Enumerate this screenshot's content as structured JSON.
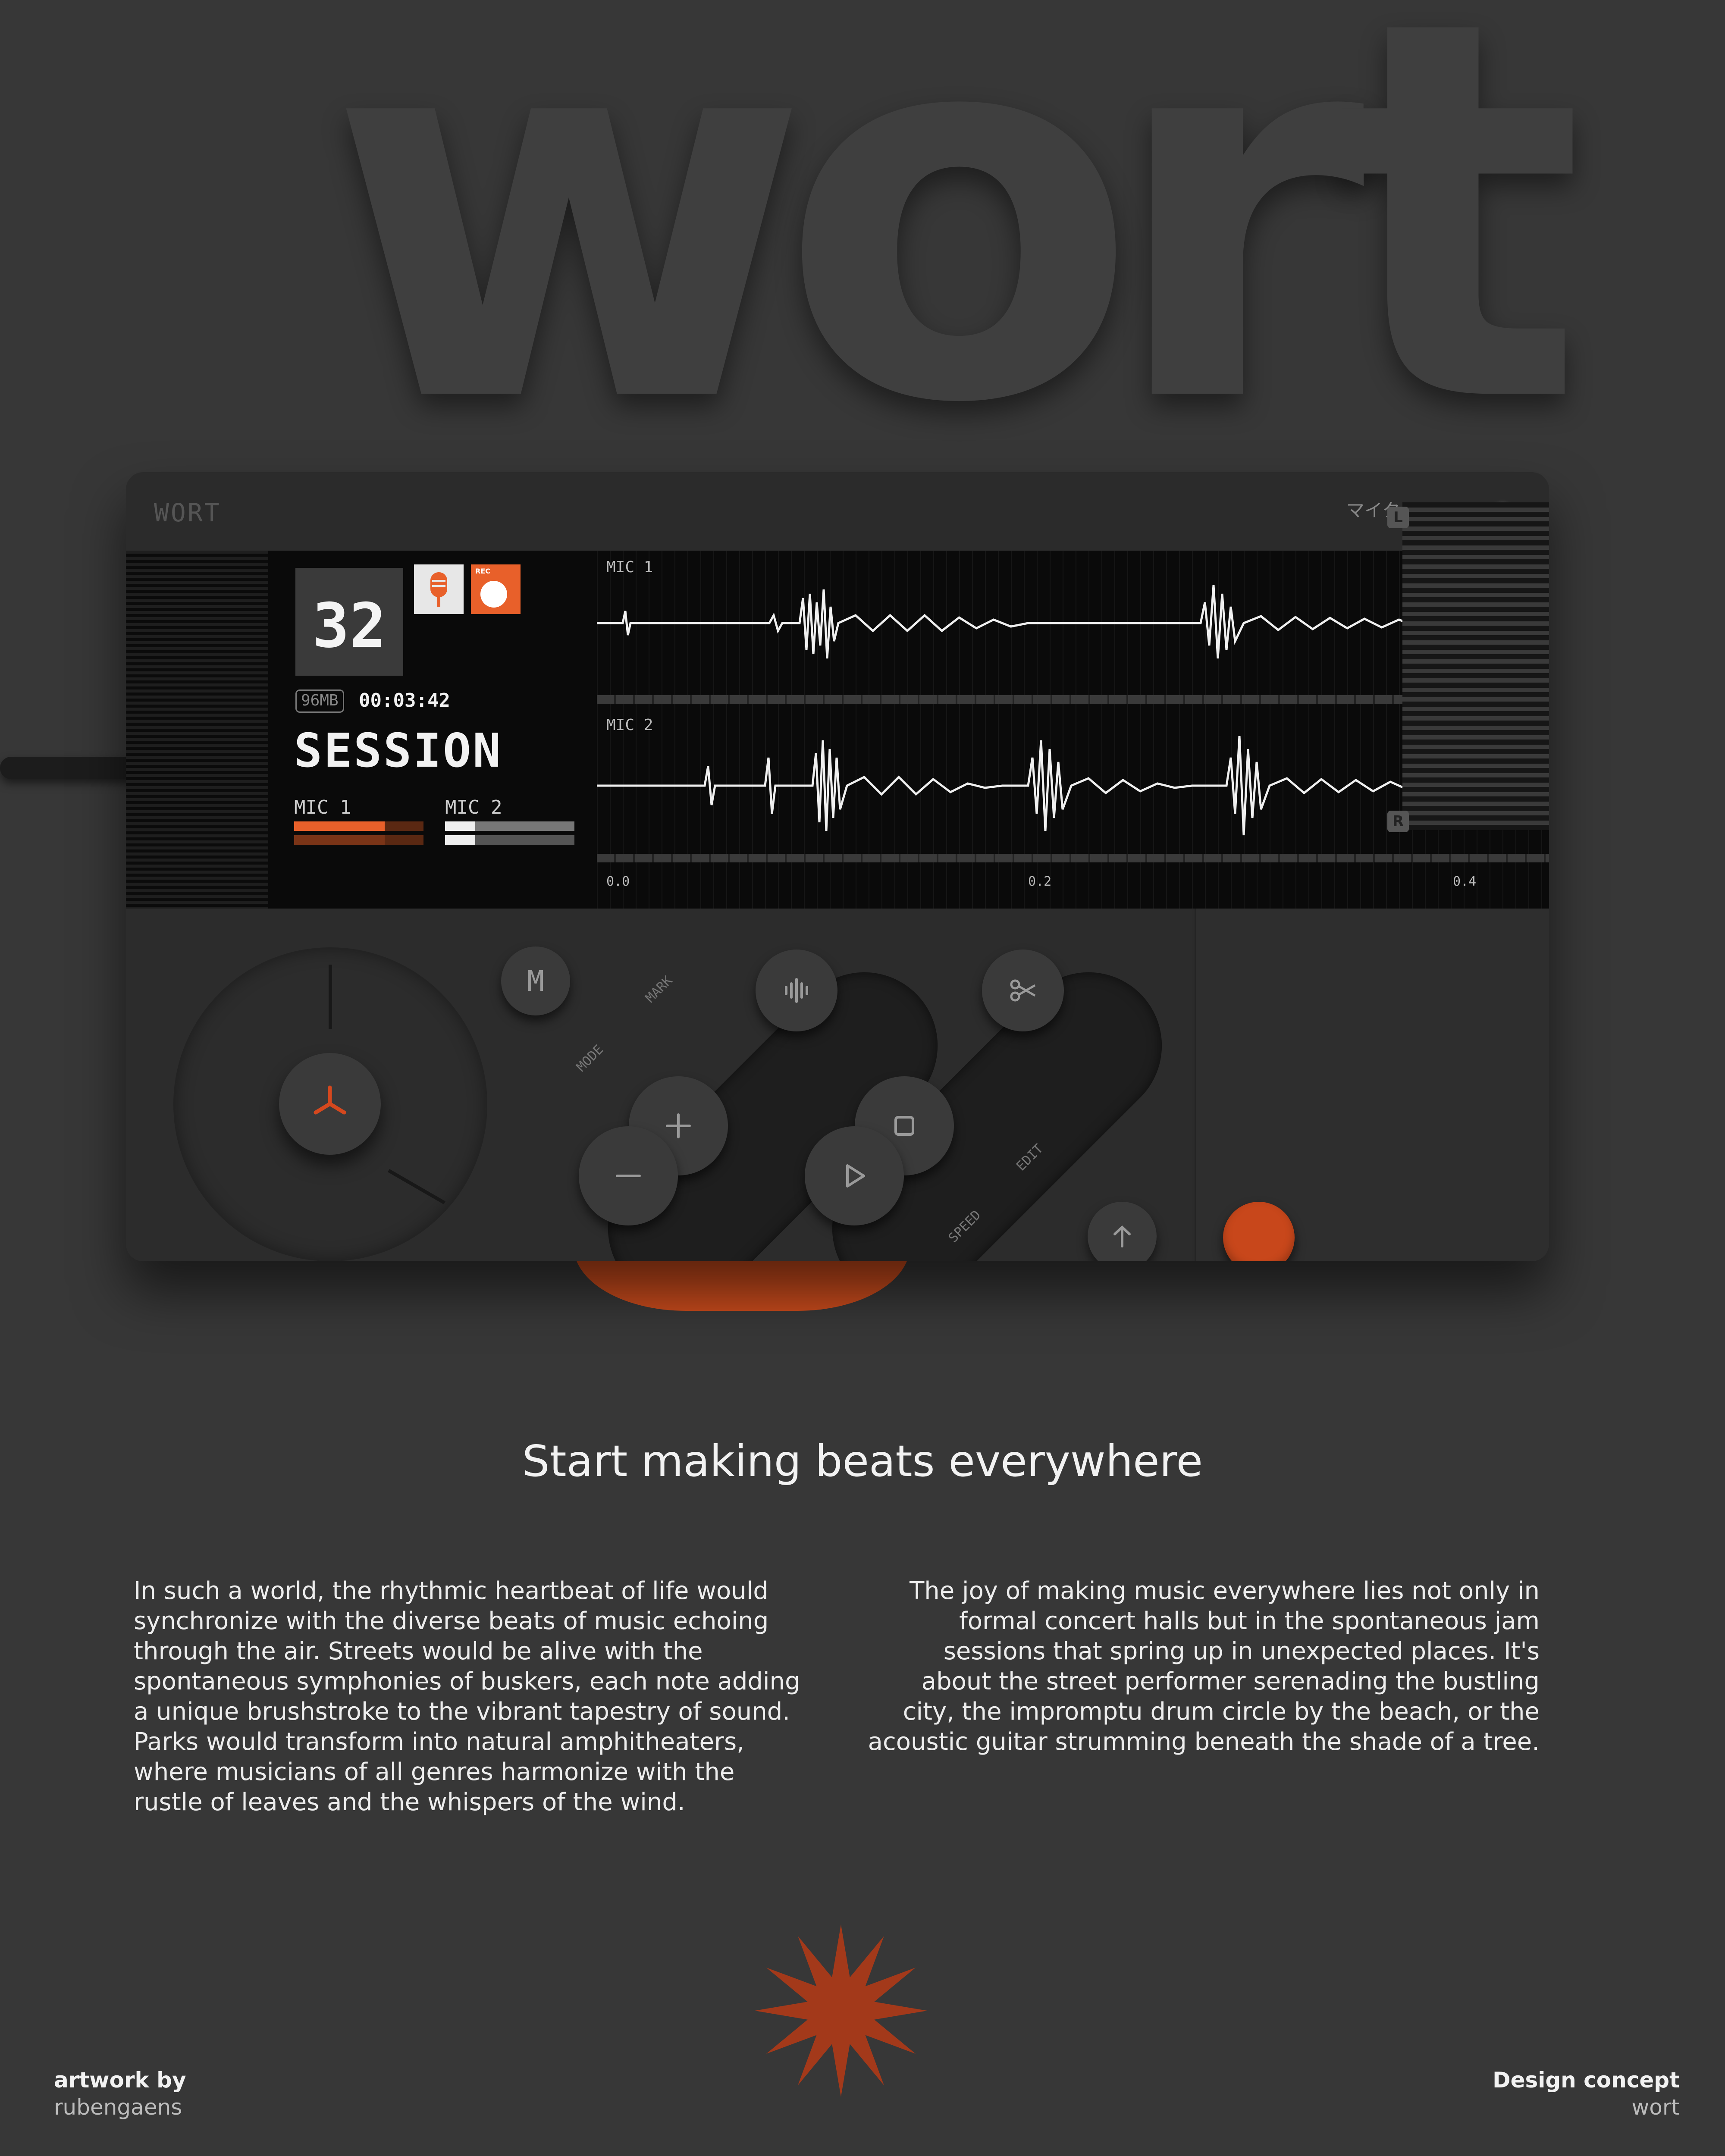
{
  "poster": {
    "big_wordmark": "wort",
    "headline": "Start making beats everywhere",
    "paragraph_left": "In such a world, the rhythmic heartbeat of life would synchronize with the diverse beats of music echoing through the air. Streets would be alive with the spontaneous symphonies of buskers, each note adding a unique brushstroke to the vibrant tapestry of sound. Parks would transform into natural amphitheaters, where musicians of all genres harmonize with the rustle of leaves and the whispers of the wind.",
    "paragraph_right": "The joy of making music everywhere lies not only in formal concert halls but in the spontaneous jam sessions that spring up in unexpected places. It's about the street performer serenading the bustling city, the impromptu drum circle by the beach, or the acoustic guitar strumming beneath the shade of a tree.",
    "credit_label": "artwork by",
    "credit_name": "rubengaens",
    "concept_label": "Design concept",
    "concept_name": "wort"
  },
  "device": {
    "brand": "WORT",
    "screen": {
      "counter": "32",
      "rec_label": "REC",
      "storage": "96MB",
      "time": "00:03:42",
      "session": "SESSION",
      "mic1_label": "MIC 1",
      "mic2_label": "MIC 2",
      "track1_label": "MIC 1",
      "track2_label": "MIC 2",
      "timeline": [
        "0.0",
        "0.2",
        "0.4"
      ]
    },
    "controls": {
      "m_button": "M",
      "mode_label": "MODE",
      "mark_label": "MARK",
      "speed_label": "SPEED",
      "edit_label": "EDIT",
      "mic_label_jp": "マイク",
      "channel_left": "L",
      "channel_right": "R"
    }
  },
  "colors": {
    "background": "#373737",
    "accent_orange": "#e8602a",
    "record_red": "#c8471b",
    "star": "#a3391a"
  },
  "icons": [
    "microphone-icon",
    "record-icon",
    "waveform-icon",
    "scissors-icon",
    "plus-icon",
    "minus-icon",
    "stop-icon",
    "play-icon",
    "arrow-up-icon",
    "starburst-icon"
  ]
}
